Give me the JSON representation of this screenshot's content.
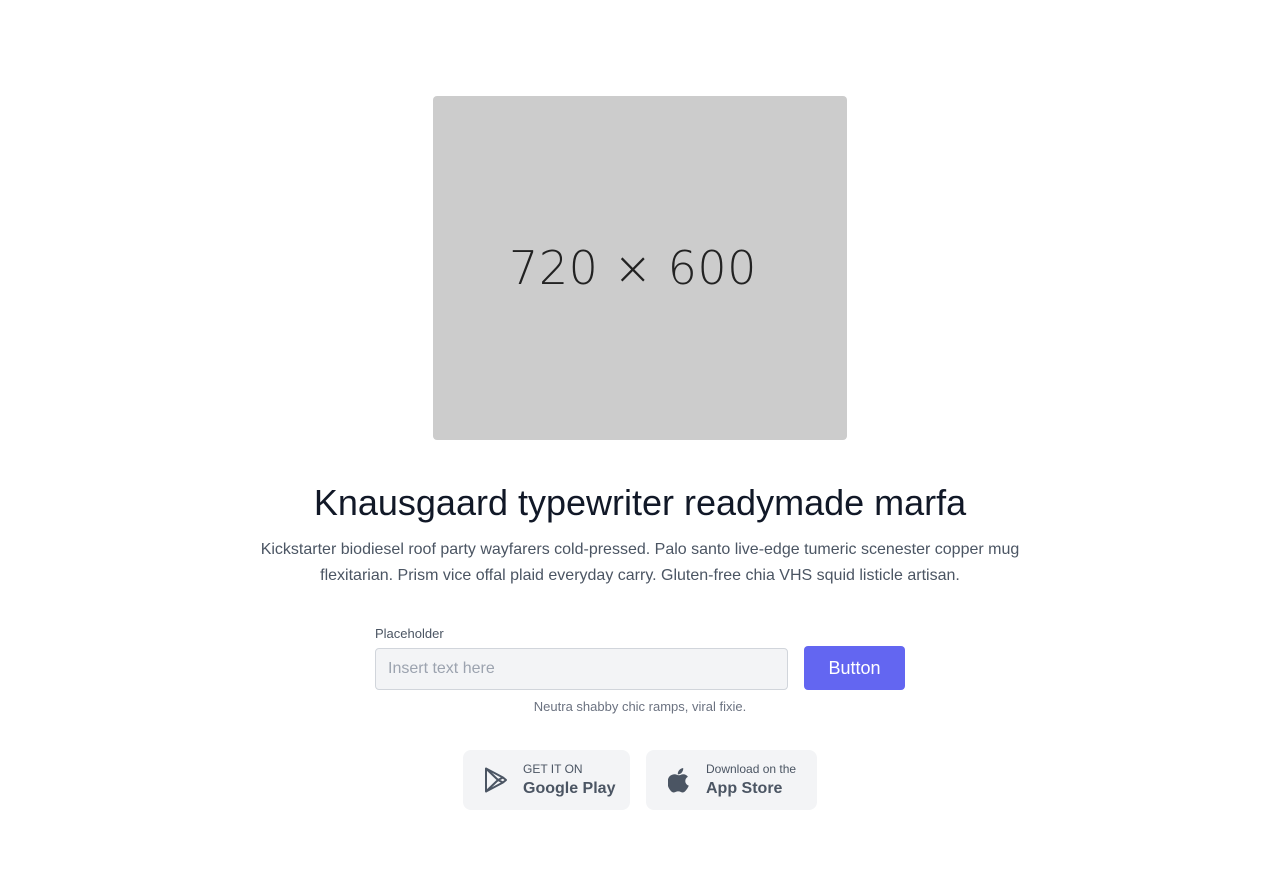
{
  "hero": {
    "image_label": "720 × 600"
  },
  "content": {
    "title": "Knausgaard typewriter readymade marfa",
    "description": "Kickstarter biodiesel roof party wayfarers cold-pressed. Palo santo live-edge tumeric scenester copper mug flexitarian. Prism vice offal plaid everyday carry. Gluten-free chia VHS squid listicle artisan."
  },
  "form": {
    "label": "Placeholder",
    "input_value": "",
    "input_placeholder": "Insert text here",
    "button_label": "Button",
    "helper_text": "Neutra shabby chic ramps, viral fixie."
  },
  "stores": {
    "google": {
      "small": "GET IT ON",
      "big": "Google Play",
      "icon": "google-play-icon"
    },
    "apple": {
      "small": "Download on the",
      "big": "App Store",
      "icon": "apple-icon"
    }
  },
  "colors": {
    "accent": "#6366f1",
    "placeholder_image": "#cccccc",
    "title": "#111827",
    "body_text": "#4b5563",
    "store_bg": "#f3f4f6"
  }
}
